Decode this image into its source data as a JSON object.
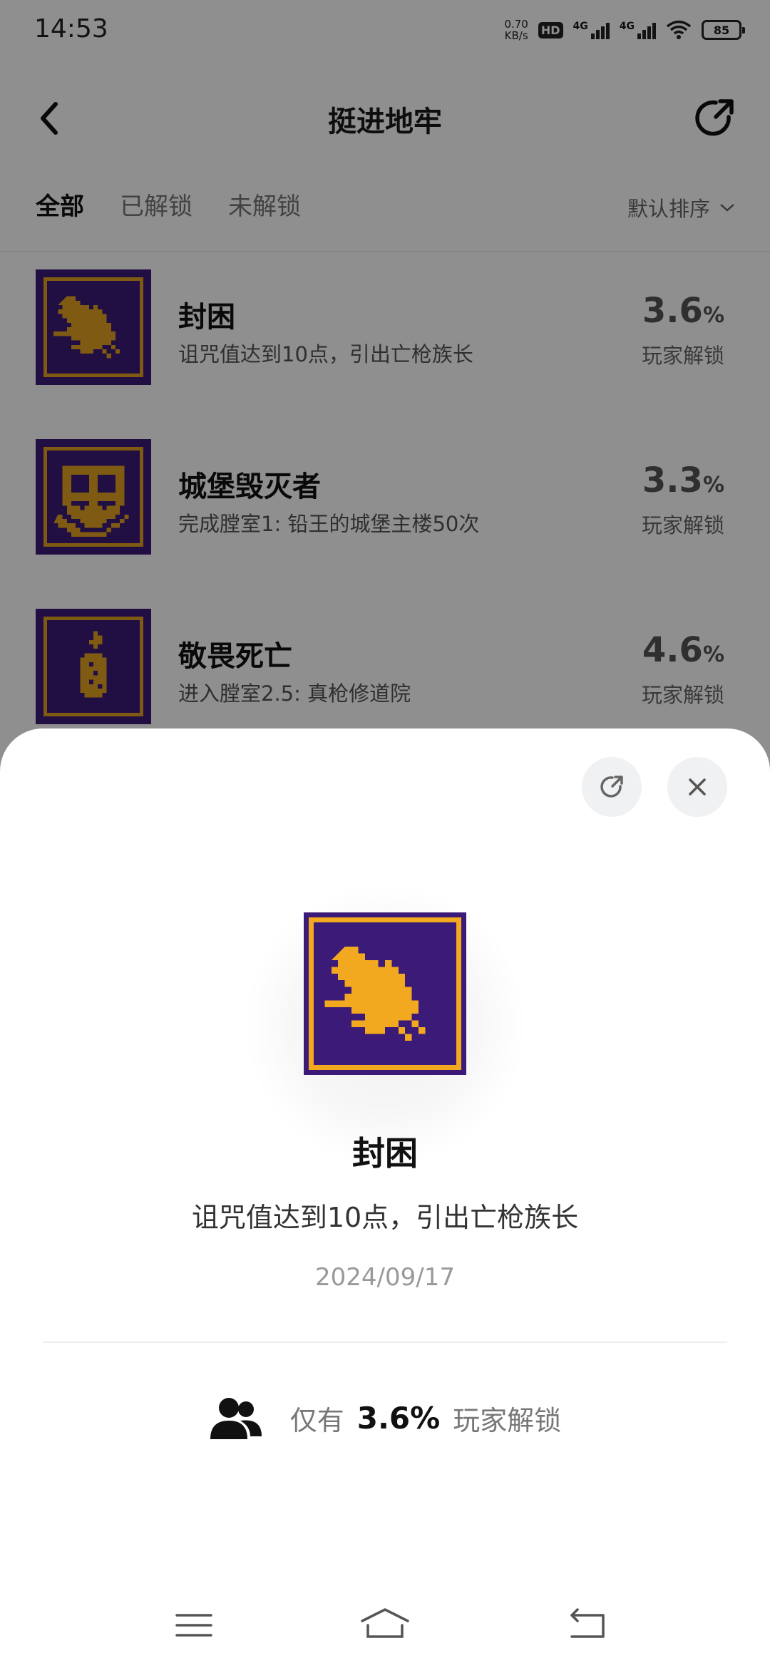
{
  "status": {
    "time": "14:53",
    "net_speed": "0.70",
    "net_unit": "KB/s",
    "hd": "HD",
    "sig1": "4G",
    "sig2": "4G",
    "battery": "85"
  },
  "header": {
    "title": "挺进地牢"
  },
  "tabs": [
    {
      "label": "全部",
      "active": true
    },
    {
      "label": "已解锁",
      "active": false
    },
    {
      "label": "未解锁",
      "active": false
    }
  ],
  "sort": {
    "label": "默认排序"
  },
  "achievements": [
    {
      "name": "封困",
      "desc": "诅咒值达到10点，引出亡枪族长",
      "pct": "3.6",
      "pct_unit": "%",
      "pct_label": "玩家解锁",
      "icon": "winged-creature-icon"
    },
    {
      "name": "城堡毁灭者",
      "desc": "完成膛室1: 铅王的城堡主楼50次",
      "pct": "3.3",
      "pct_unit": "%",
      "pct_label": "玩家解锁",
      "icon": "shield-icon"
    },
    {
      "name": "敬畏死亡",
      "desc": "进入膛室2.5: 真枪修道院",
      "pct": "4.6",
      "pct_unit": "%",
      "pct_label": "玩家解锁",
      "icon": "candle-icon"
    }
  ],
  "detail": {
    "title": "封困",
    "desc": "诅咒值达到10点，引出亡枪族长",
    "date": "2024/09/17",
    "stat_prefix": "仅有",
    "stat_pct": "3.6%",
    "stat_suffix": "玩家解锁"
  },
  "colors": {
    "icon_bg": "#3b1a78",
    "icon_gold": "#f2a81f"
  }
}
